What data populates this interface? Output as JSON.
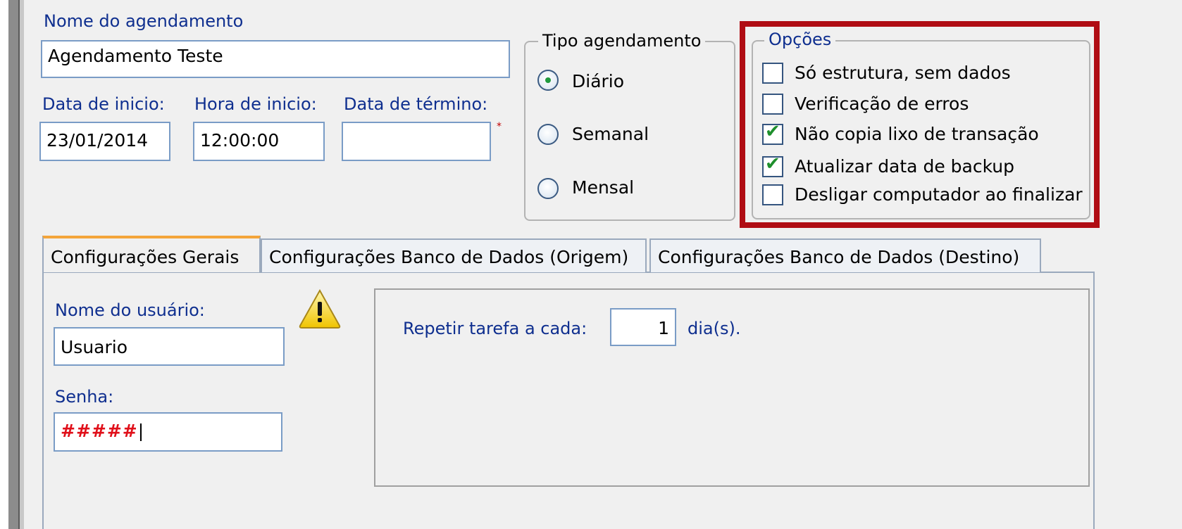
{
  "form": {
    "name_label": "Nome do agendamento",
    "name_value": "Agendamento Teste",
    "start_date_label": "Data de inicio:",
    "start_date_value": "23/01/2014",
    "start_time_label": "Hora de inicio:",
    "start_time_value": "12:00:00",
    "end_date_label": "Data de término:",
    "end_date_value": "",
    "required_mark": "*"
  },
  "schedule_type": {
    "title": "Tipo agendamento",
    "options": [
      {
        "label": "Diário",
        "selected": true
      },
      {
        "label": "Semanal",
        "selected": false
      },
      {
        "label": "Mensal",
        "selected": false
      }
    ]
  },
  "options": {
    "title": "Opções",
    "items": [
      {
        "label": "Só estrutura, sem dados",
        "checked": false
      },
      {
        "label": "Verificação de erros",
        "checked": false
      },
      {
        "label": "Não copia lixo de transação",
        "checked": true
      },
      {
        "label": "Atualizar data de backup",
        "checked": true
      },
      {
        "label": "Desligar computador ao finalizar",
        "checked": false
      }
    ],
    "highlight_color": "#b00d14"
  },
  "tabs": [
    {
      "label": "Configurações Gerais",
      "active": true
    },
    {
      "label": "Configurações Banco de Dados (Origem)",
      "active": false
    },
    {
      "label": "Configurações Banco de Dados (Destino)",
      "active": false
    }
  ],
  "general": {
    "user_label": "Nome do usuário:",
    "user_value": "Usuario",
    "password_label": "Senha:",
    "password_value": "#####",
    "warning_icon": "warning-icon",
    "repeat_label": "Repetir tarefa a cada:",
    "repeat_value": "1",
    "repeat_unit": "dia(s)."
  }
}
